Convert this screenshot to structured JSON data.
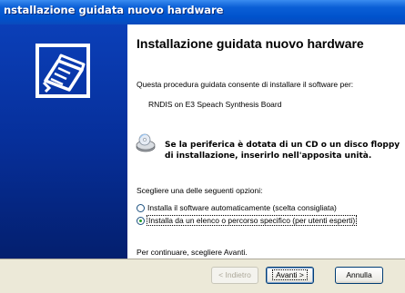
{
  "window": {
    "title": "nstallazione guidata nuovo hardware"
  },
  "wizard": {
    "heading": "Installazione guidata nuovo hardware",
    "intro": "Questa procedura guidata consente di installare il software per:",
    "device_name": "RNDIS on E3 Speach Synthesis Board",
    "cd_prompt_line1": "Se la periferica è dotata di un CD o un disco floppy",
    "cd_prompt_line2": "di installazione, inserirlo nell'apposita unità.",
    "choose_label": "Scegliere una delle seguenti opzioni:",
    "options": [
      {
        "label": "Installa il software automaticamente (scelta consigliata)",
        "selected": false
      },
      {
        "label": "Installa da un elenco o percorso specifico (per utenti esperti)",
        "selected": true
      }
    ],
    "continue_text": "Per continuare, scegliere Avanti."
  },
  "buttons": {
    "back": "< Indietro",
    "next": "Avanti >",
    "cancel": "Annulla"
  },
  "colors": {
    "titlebar": "#0052cc",
    "side_panel": "#062f9a",
    "dialog_face": "#ece9d8",
    "radio_selected": "#27a327"
  },
  "icons": {
    "wizard": "hardware-wizard-icon",
    "cd": "cd-drive-icon"
  }
}
